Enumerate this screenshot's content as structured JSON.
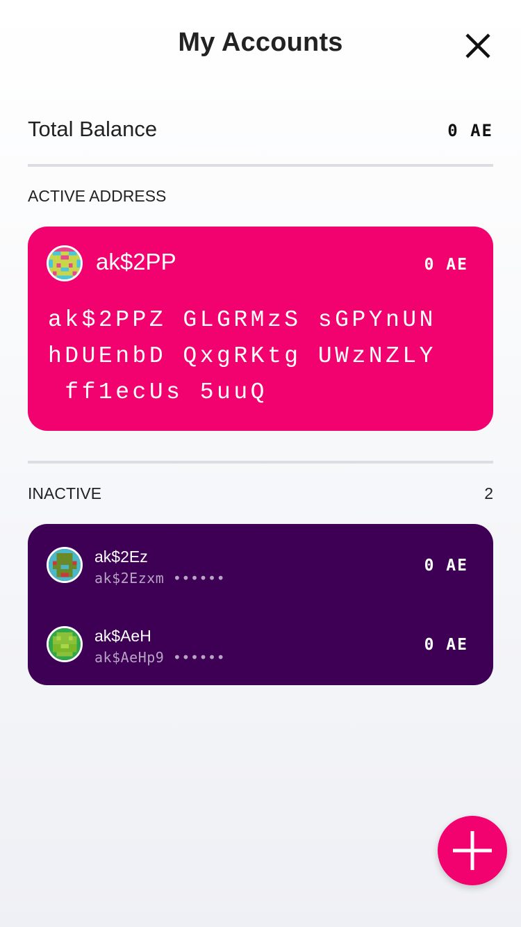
{
  "header": {
    "title": "My Accounts",
    "close_icon": "close-icon"
  },
  "total": {
    "label": "Total Balance",
    "value": "0 AE"
  },
  "active": {
    "section_label": "ACTIVE ADDRESS",
    "name": "ak$2PP",
    "balance": "0 AE",
    "address_lines": [
      "ak$2PPZ GLGRMzS sGPYnUN",
      "hDUEnbD QxgRKtg UWzNZLY",
      " ff1ecUs 5uuQ"
    ],
    "card_color": "#f2026e"
  },
  "inactive": {
    "section_label": "INACTIVE",
    "count": "2",
    "card_color": "#3d0054",
    "accounts": [
      {
        "name": "ak$2Ez",
        "address": "ak$2Ezxm ••••••",
        "balance": "0 AE"
      },
      {
        "name": "ak$AeH",
        "address": "ak$AeHp9 ••••••",
        "balance": "0 AE"
      }
    ]
  },
  "fab": {
    "icon": "plus-icon"
  }
}
